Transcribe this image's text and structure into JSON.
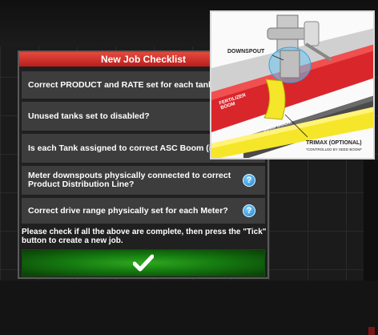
{
  "dialog": {
    "title": "New Job Checklist",
    "items": [
      {
        "label": "Correct PRODUCT and RATE set for each tank being used?"
      },
      {
        "label": "Unused tanks set to disabled?"
      },
      {
        "label": "Is each Tank assigned to correct ASC Boom (if equipped)?"
      },
      {
        "label": "Meter downspouts physically connected to correct Product Distribution Line?",
        "help": "?"
      },
      {
        "label": "Correct drive range physically set for each Meter?",
        "help": "?"
      }
    ],
    "instructions": "Please check if all the above are complete, then press the \"Tick\" button to create a new job.",
    "tick_icon": "checkmark-icon"
  },
  "diagram": {
    "downspout_label": "DOWNSPOUT",
    "fertilizer_boom_label": "FERTILIZER BOOM",
    "seed_boom_label": "SEED BOOM",
    "trimax_label": "TRIMAX (OPTIONAL)",
    "trimax_sub_label": "*CONTROLLED BY SEED BOOM*"
  },
  "colors": {
    "title_bar": "#d32f2f",
    "row_bg": "#3d3d3d",
    "tick_button": "#1e8e16",
    "help_icon": "#1d7fd6",
    "fertilizer_boom": "#d9262b",
    "trimax_boom": "#f5e62a",
    "seed_boom": "#4a4a4a"
  }
}
